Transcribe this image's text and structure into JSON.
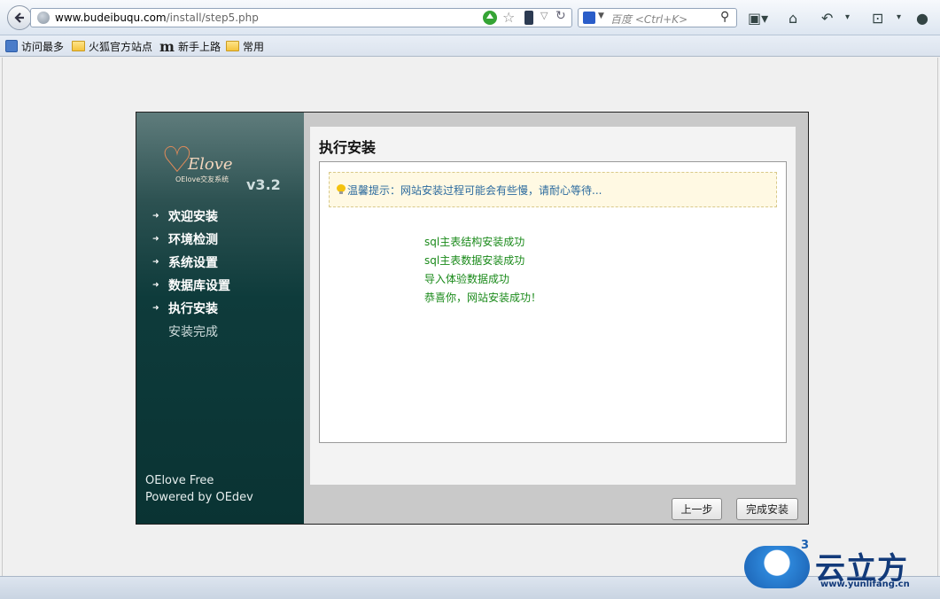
{
  "browser": {
    "url_host": "www.budeibuqu.com",
    "url_path": "/install/step5.php",
    "search_placeholder": "百度 <Ctrl+K>"
  },
  "bookmarks": [
    {
      "label": "访问最多",
      "icon": "bookmark-most-visited-icon"
    },
    {
      "label": "火狐官方站点",
      "icon": "folder-icon"
    },
    {
      "label": "新手上路",
      "icon": "m-icon"
    },
    {
      "label": "常用",
      "icon": "folder-icon"
    }
  ],
  "sidebar": {
    "logo_text": "OElove交友系统",
    "version": "v3.2",
    "nav": [
      {
        "label": "欢迎安装"
      },
      {
        "label": "环境检测"
      },
      {
        "label": "系统设置"
      },
      {
        "label": "数据库设置"
      },
      {
        "label": "执行安装"
      },
      {
        "label": "安装完成"
      }
    ],
    "footer_line1": "OElove Free",
    "footer_line2": "Powered by OEdev"
  },
  "main": {
    "title": "执行安装",
    "tip": "温馨提示：网站安装过程可能会有些慢，请耐心等待...",
    "results": [
      "sql主表结构安装成功",
      "sql主表数据安装成功",
      "导入体验数据成功",
      "恭喜你，网站安装成功！"
    ],
    "prev_label": "上一步",
    "finish_label": "完成安装"
  },
  "watermark": {
    "brand": "云立方",
    "sup": "3",
    "url": "www.yunlifang.cn"
  },
  "colors": {
    "sidebar": "#0e3b3b",
    "success_text": "#1a8a1a",
    "tip_text": "#2b6a9e",
    "tip_bg": "#fff9e3"
  }
}
